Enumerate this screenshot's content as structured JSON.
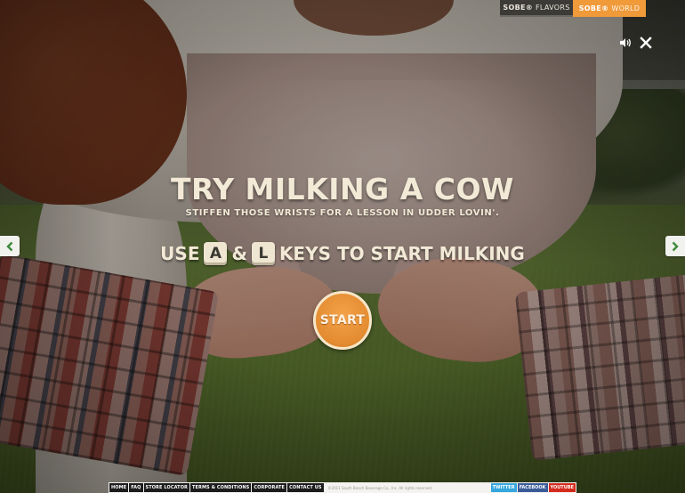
{
  "top_nav": {
    "flavors_brand": "SOBE®",
    "flavors_label": "FLAVORS",
    "world_brand": "SOBE®",
    "world_label": "WORLD"
  },
  "controls": {
    "sound_icon": "speaker-icon",
    "close_icon": "close-icon"
  },
  "game": {
    "title": "TRY MILKING A COW",
    "subtitle": "STIFFEN THOSE WRISTS FOR A LESSON IN UDDER LOVIN'.",
    "instruction_prefix": "USE",
    "key_a": "A",
    "ampersand": "&",
    "key_l": "L",
    "instruction_suffix": "KEYS TO START MILKING",
    "start_label": "START"
  },
  "navigation": {
    "prev_icon": "chevron-left-icon",
    "next_icon": "chevron-right-icon"
  },
  "footer": {
    "links": [
      "HOME",
      "FAQ",
      "STORE LOCATOR",
      "TERMS & CONDITIONS",
      "CORPORATE",
      "CONTACT US"
    ],
    "copyright": "©2011 South Beach Beverage Co., Inc. All rights reserved.",
    "social": [
      "TWITTER",
      "FACEBOOK",
      "YOUTUBE"
    ]
  },
  "colors": {
    "accent_orange": "#f09a3a",
    "title_cream": "#f2e9d6",
    "twitter": "#35a7dd",
    "facebook": "#3b5b98",
    "youtube": "#d42b1e"
  }
}
